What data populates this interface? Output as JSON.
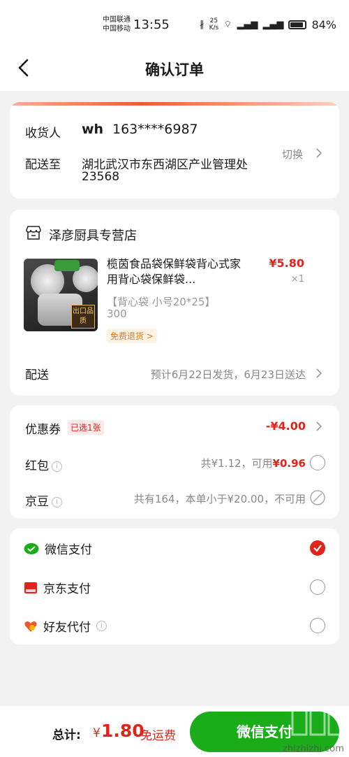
{
  "status_bar": {
    "carrier_1": "中国联通",
    "carrier_2": "中国移动",
    "time": "13:55",
    "net_speed_value": "25",
    "net_speed_unit": "K/s",
    "battery": "84%"
  },
  "header": {
    "title": "确认订单"
  },
  "address": {
    "receiver_label": "收货人",
    "receiver_name": "wh",
    "receiver_phone": "163****6987",
    "deliver_label": "配送至",
    "address_line1": "湖北武汉市东西湖区产业管理处",
    "address_line2": "23568",
    "switch_label": "切换"
  },
  "shop": {
    "name": "泽彦厨具专营店",
    "product": {
      "title": "榄茵食品袋保鲜袋背心式家用背心袋保鲜袋...",
      "price": "¥5.80",
      "qty": "×1",
      "spec": "【背心袋 小号20*25】",
      "spec2": "300",
      "tag": "免费退货 >",
      "image_badge": "出口品质"
    },
    "delivery_label": "配送",
    "delivery_info": "预计6月22日发货，6月23日送达"
  },
  "discounts": {
    "coupon_label": "优惠券",
    "coupon_badge": "已选1张",
    "coupon_value": "-¥4.00",
    "redpacket_label": "红包",
    "redpacket_info_prefix": "共¥1.12，可用",
    "redpacket_info_value": "¥0.96",
    "beans_label": "京豆",
    "beans_info": "共有164，本单小于¥20.00，不可用"
  },
  "payment": {
    "options": [
      {
        "label": "微信支付",
        "selected": true
      },
      {
        "label": "京东支付",
        "selected": false
      },
      {
        "label": "好友代付",
        "selected": false
      }
    ]
  },
  "bottom": {
    "total_label": "总计:",
    "currency": "¥",
    "total_value": "1.80",
    "shipping": "免运费",
    "pay_button": "微信支付"
  },
  "watermark": {
    "text": "zhizhizhi.com",
    "logo": "值值值"
  },
  "colors": {
    "accent_red": "#e2231a",
    "wechat_green": "#1aad19"
  }
}
